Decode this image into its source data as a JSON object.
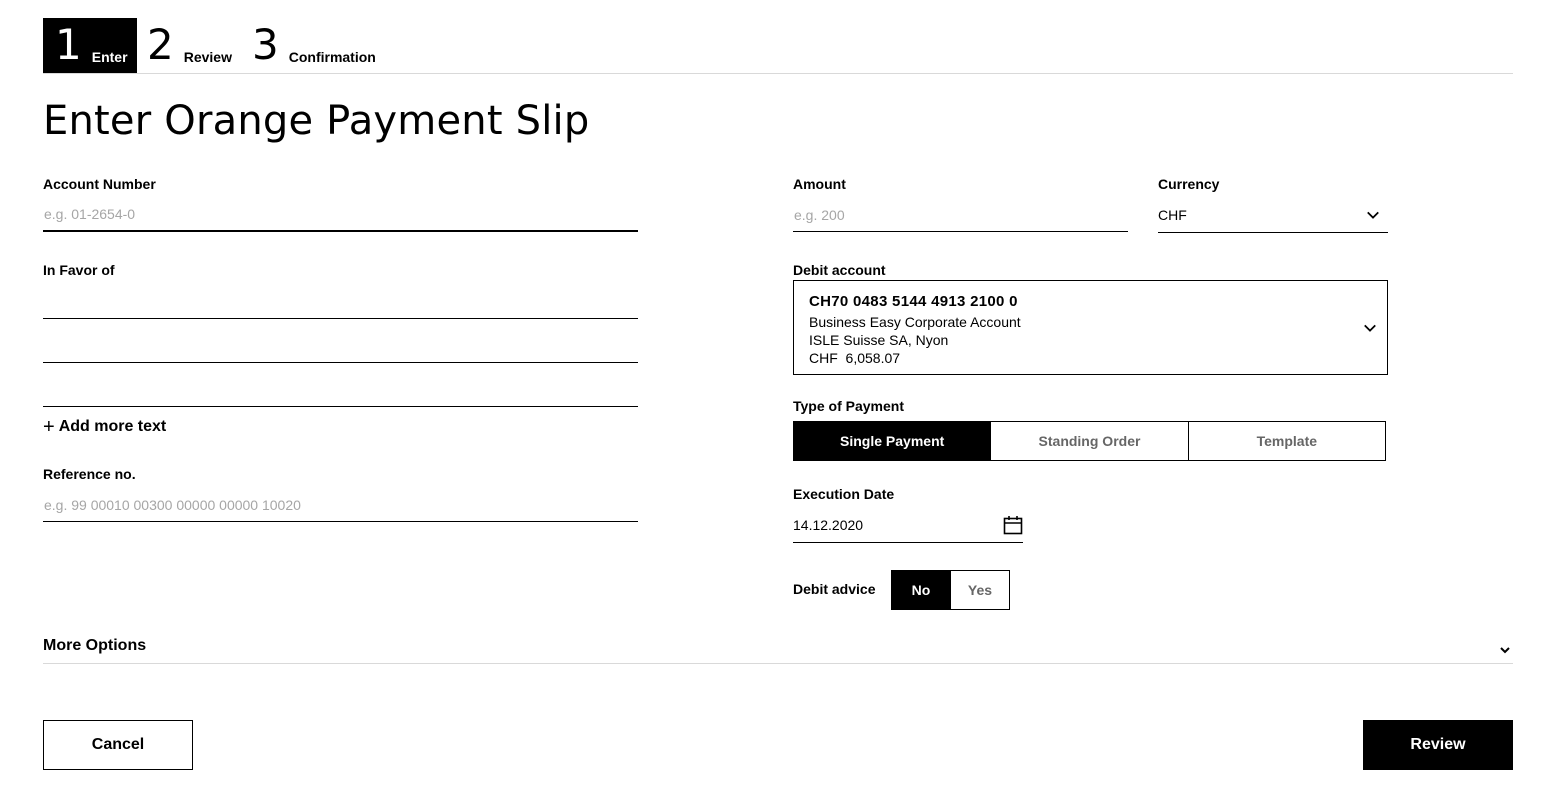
{
  "stepper": {
    "steps": [
      {
        "number": "1",
        "label": "Enter",
        "active": true
      },
      {
        "number": "2",
        "label": "Review",
        "active": false
      },
      {
        "number": "3",
        "label": "Confirmation",
        "active": false
      }
    ]
  },
  "page": {
    "title": "Enter Orange Payment Slip"
  },
  "left": {
    "account_number": {
      "label": "Account Number",
      "placeholder": "e.g. 01-2654-0",
      "value": ""
    },
    "in_favor_of": {
      "label": "In Favor of",
      "lines": [
        "",
        "",
        ""
      ]
    },
    "add_more_text": "Add more text",
    "reference": {
      "label": "Reference no.",
      "placeholder": "e.g. 99 00010 00300 00000 00000 10020",
      "value": ""
    }
  },
  "right": {
    "amount": {
      "label": "Amount",
      "placeholder": "e.g. 200",
      "value": ""
    },
    "currency": {
      "label": "Currency",
      "value": "CHF"
    },
    "debit_account": {
      "label": "Debit account",
      "iban": "CH70 0483 5144 4913 2100 0",
      "name": "Business Easy Corporate Account",
      "holder": "ISLE Suisse SA, Nyon",
      "balance": "CHF  6,058.07"
    },
    "type_of_payment": {
      "label": "Type of Payment",
      "options": [
        "Single Payment",
        "Standing Order",
        "Template"
      ],
      "selected": "Single Payment"
    },
    "execution_date": {
      "label": "Execution Date",
      "value": "14.12.2020"
    },
    "debit_advice": {
      "label": "Debit advice",
      "options": [
        "No",
        "Yes"
      ],
      "selected": "No"
    }
  },
  "more_options": {
    "label": "More Options"
  },
  "actions": {
    "cancel": "Cancel",
    "review": "Review"
  },
  "icons": {
    "chevron": "chevron-down-icon",
    "calendar": "calendar-icon",
    "plus": "plus-icon"
  }
}
